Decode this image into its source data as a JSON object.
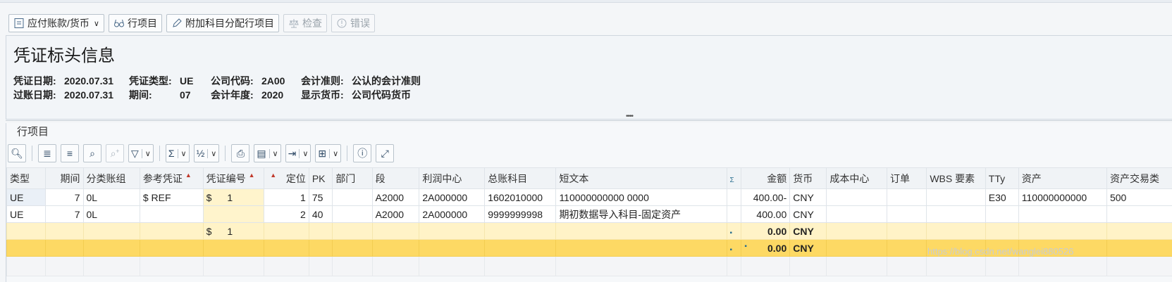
{
  "toolbar": {
    "view_label": "应付账款/货币",
    "line_items_label": "行项目",
    "additional_assignments_label": "附加科目分配行项目",
    "check_label": "检查",
    "errors_label": "错误"
  },
  "header": {
    "title": "凭证标头信息",
    "doc_date_label": "凭证日期:",
    "doc_date": "2020.07.31",
    "doc_type_label": "凭证类型:",
    "doc_type": "UE",
    "company_code_label": "公司代码:",
    "company_code": "2A00",
    "acct_principle_label": "会计准则:",
    "acct_principle": "公认的会计准则",
    "posting_date_label": "过账日期:",
    "posting_date": "2020.07.31",
    "period_label": "期间:",
    "period": "07",
    "fiscal_year_label": "会计年度:",
    "fiscal_year": "2020",
    "display_currency_label": "显示货币:",
    "display_currency": "公司代码货币"
  },
  "panel": {
    "title": "行项目"
  },
  "table": {
    "columns": [
      "类型",
      "期间",
      "分类账组",
      "参考凭证",
      "凭证编号",
      "定位",
      "PK",
      "部门",
      "段",
      "利润中心",
      "总账科目",
      "短文本",
      "",
      "金额",
      "货币",
      "成本中心",
      "订单",
      "WBS 要素",
      "TTy",
      "资产",
      "资产交易类"
    ],
    "rows": [
      [
        "UE",
        "7",
        "0L",
        "$ REF",
        "$",
        "1",
        "1",
        "75",
        "",
        "A2000",
        "2A000000",
        "1602010000",
        "110000000000 0000",
        "",
        "400.00-",
        "CNY",
        "",
        "",
        "",
        "E30",
        "110000000000",
        "500"
      ],
      [
        "UE",
        "7",
        "0L",
        "",
        "",
        "",
        "2",
        "40",
        "",
        "A2000",
        "2A000000",
        "9999999998",
        "期初数据导入科目-固定资产",
        "",
        "400.00",
        "CNY",
        "",
        "",
        "",
        "",
        "",
        ""
      ]
    ],
    "subtotal": {
      "doc_prefix": "$",
      "doc_no": "1",
      "amount": "0.00",
      "currency": "CNY"
    },
    "total": {
      "amount": "0.00",
      "currency": "CNY"
    }
  },
  "watermark": "https://blog.csdn.net/wanglei880526",
  "colors": {
    "key_cell": "#fff4cc",
    "subtotal_row": "#fff3c7",
    "total_row": "#fdd964"
  }
}
